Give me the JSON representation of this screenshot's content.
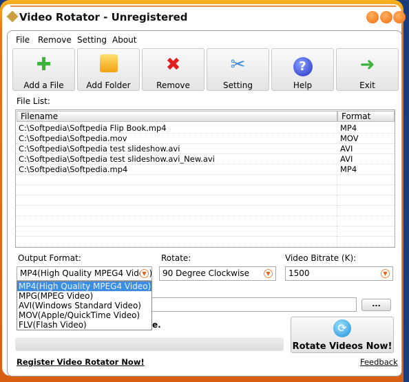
{
  "window": {
    "title": "Video Rotator - Unregistered"
  },
  "menu": [
    "File",
    "Remove",
    "Setting",
    "About"
  ],
  "toolbar": [
    {
      "label": "Add a File",
      "icon": "plus-icon",
      "color": "#3cb43c"
    },
    {
      "label": "Add Folder",
      "icon": "folder-icon",
      "color": "#f2b21c"
    },
    {
      "label": "Remove",
      "icon": "x-icon",
      "color": "#e02020"
    },
    {
      "label": "Setting",
      "icon": "tools-icon",
      "color": "#3a8ad8"
    },
    {
      "label": "Help",
      "icon": "help-icon",
      "color": "#2a3fd0"
    },
    {
      "label": "Exit",
      "icon": "arrow-right-icon",
      "color": "#3cb43c"
    }
  ],
  "file_list": {
    "label": "File List:",
    "columns": [
      "Filename",
      "Format"
    ],
    "rows": [
      [
        "C:\\Softpedia\\Softpedia Flip Book.mp4",
        "MP4"
      ],
      [
        "C:\\Softpedia\\Softpedia.mov",
        "MOV"
      ],
      [
        "C:\\Softpedia\\Softpedia test slideshow.avi",
        "AVI"
      ],
      [
        "C:\\Softpedia\\Softpedia test slideshow.avi_New.avi",
        "AVI"
      ],
      [
        "C:\\Softpedia\\Softpedia.mp4",
        "MP4"
      ]
    ]
  },
  "output_format": {
    "label": "Output Format:",
    "value": "MP4(High Quality MPEG4 Video)",
    "options": [
      "MP4(High Quality MPEG4 Video)",
      "MPG(MPEG Video)",
      "AVI(Windows Standard Video)",
      "MOV(Apple/QuickTime Video)",
      "FLV(Flash Video)"
    ]
  },
  "rotate": {
    "label": "Rotate:",
    "value": "90 Degree Clockwise"
  },
  "bitrate": {
    "label": "Video Bitrate (K):",
    "value": "1500"
  },
  "browse_label": "...",
  "obscured_text_tail": "e.",
  "progress": 0,
  "rotate_button": "Rotate Videos Now!",
  "register_link": "Register Video Rotator Now!",
  "feedback_link": "Feedback",
  "accent": "#f08a3a"
}
